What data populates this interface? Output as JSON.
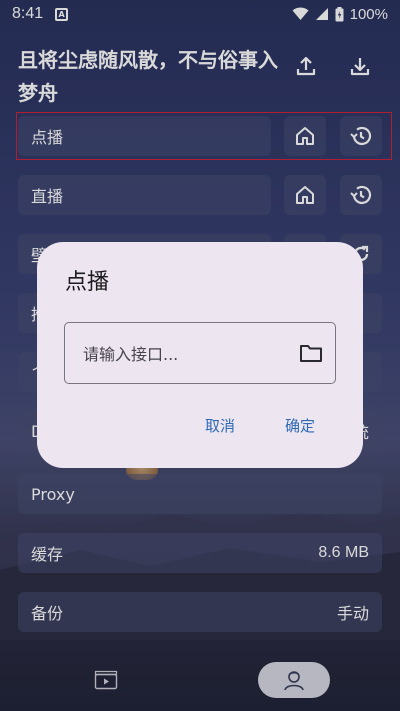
{
  "status": {
    "time": "8:41",
    "notif_letter": "A",
    "battery": "100%"
  },
  "header": {
    "title": "且将尘虑随风散，不与俗事入梦舟",
    "upload_icon": "upload-icon",
    "download_icon": "download-icon"
  },
  "rows": {
    "vod": {
      "label": "点播"
    },
    "live": {
      "label": "直播"
    },
    "wallpaper": {
      "label": "壁"
    },
    "row4": {
      "label": "推"
    },
    "row5": {
      "label": "ㄟ"
    },
    "row6": {
      "label": "D",
      "value_right": "统"
    },
    "proxy": {
      "label": "Proxy"
    },
    "cache": {
      "label": "缓存",
      "value": "8.6 MB"
    },
    "backup": {
      "label": "备份",
      "value": "手动"
    }
  },
  "dialog": {
    "title": "点播",
    "input_placeholder": "请输入接口...",
    "cancel": "取消",
    "confirm": "确定"
  },
  "colors": {
    "accent": "#2f6ab5",
    "highlight": "#d0243a",
    "dialog_bg": "#ede6f1"
  }
}
